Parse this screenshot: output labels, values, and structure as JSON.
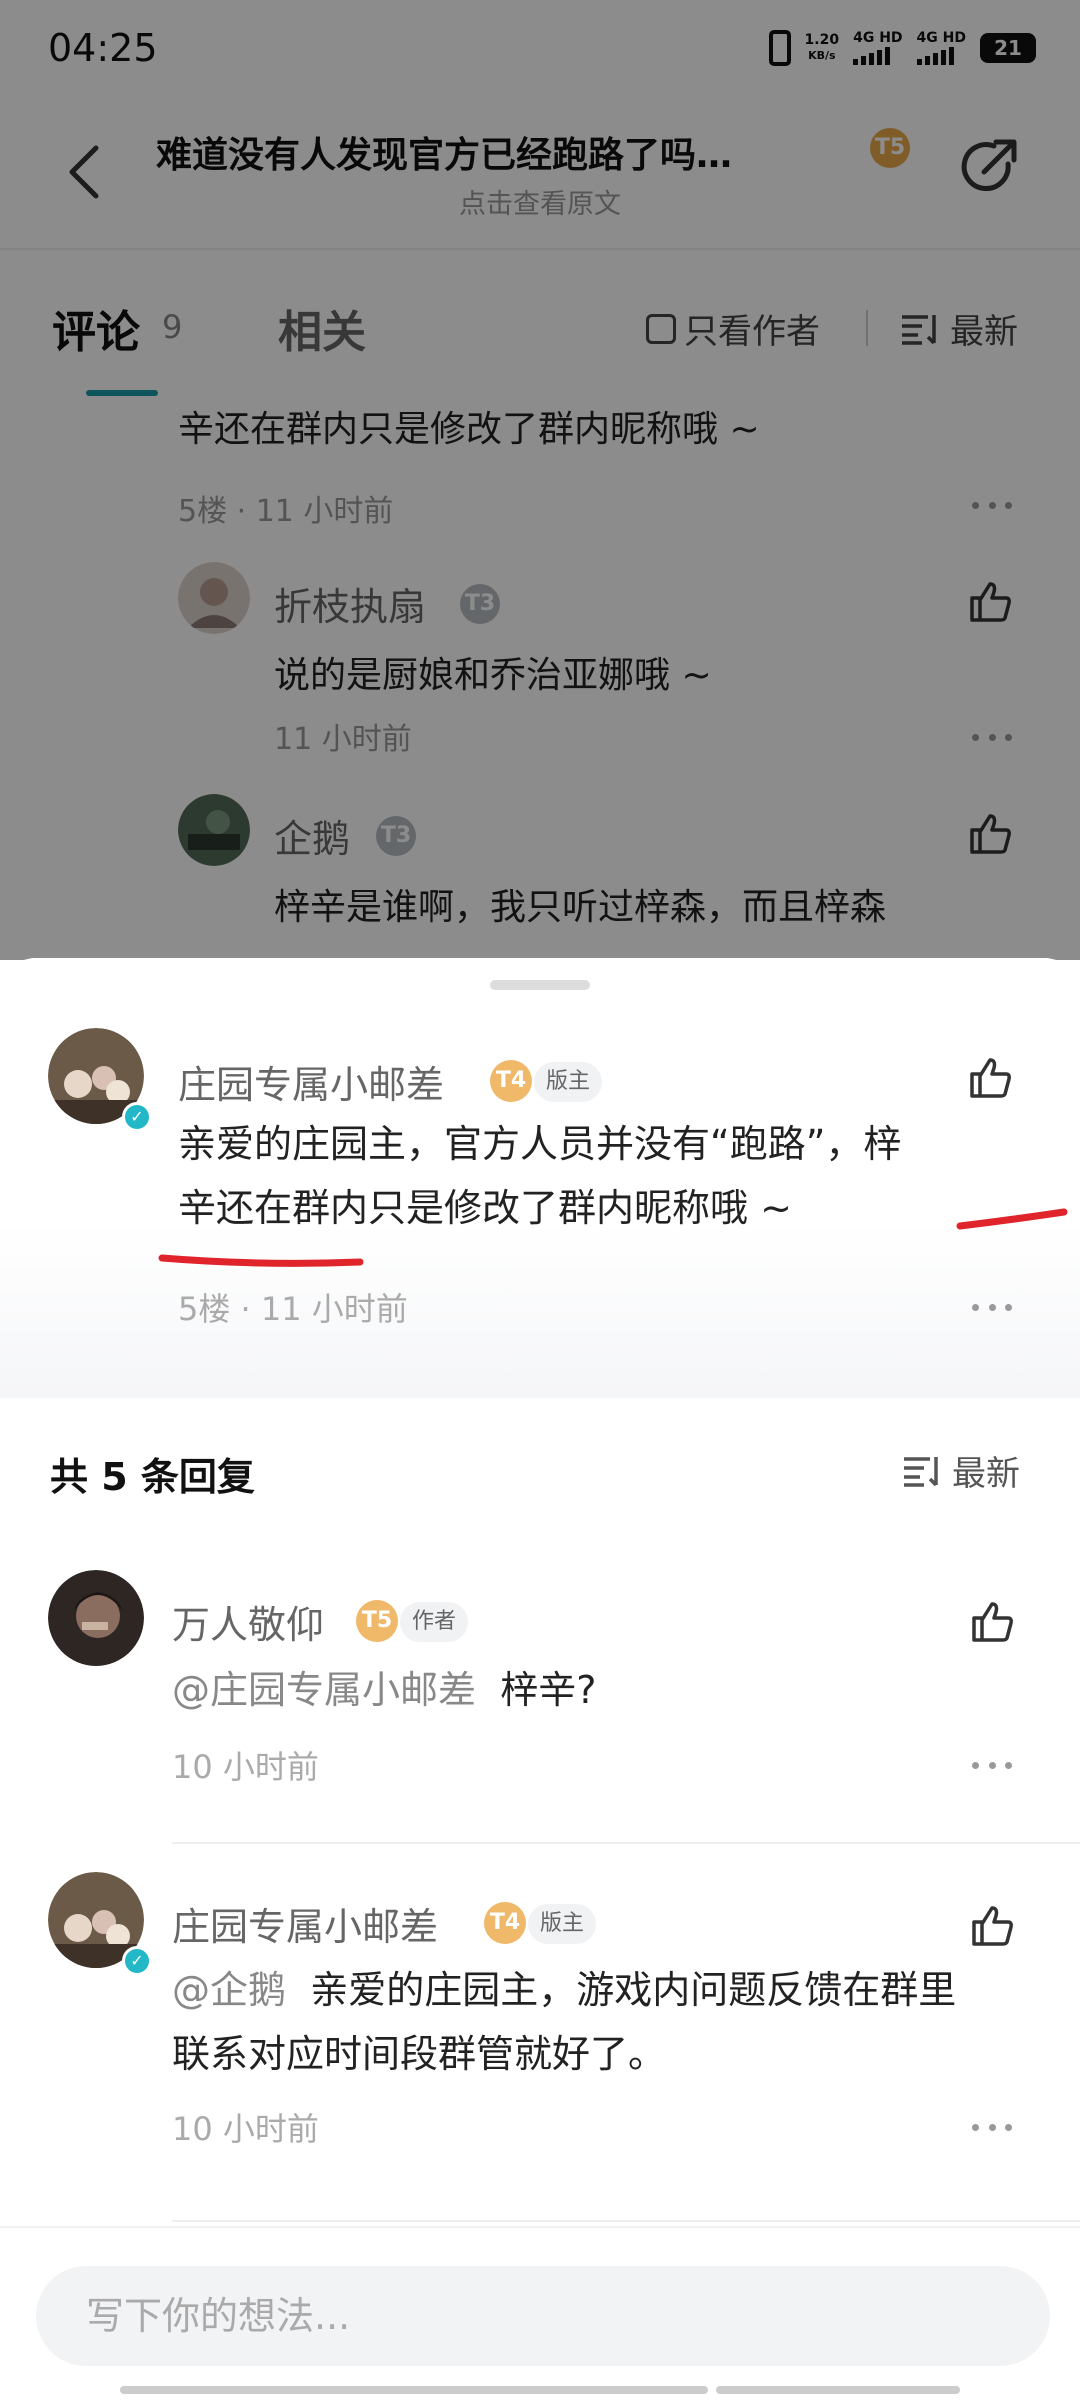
{
  "status_bar": {
    "time": "04:25",
    "speed_value": "1.20",
    "speed_unit": "KB/s",
    "net1": "4G HD",
    "net2": "4G HD",
    "battery": "21"
  },
  "header": {
    "title": "难道没有人发现官方已经跑路了吗…",
    "subtitle": "点击查看原文",
    "author_level": "T5"
  },
  "tabs": {
    "comments_label": "评论",
    "comments_count": "9",
    "related_label": "相关",
    "author_only_label": "只看作者",
    "sort_label": "最新"
  },
  "background_thread": {
    "top_text": "辛还在群内只是修改了群内昵称哦 ~",
    "top_meta": "5楼  ·  11 小时前",
    "replies": [
      {
        "name": "折枝执扇",
        "level": "T3",
        "text": "说的是厨娘和乔治亚娜哦 ~",
        "time": "11 小时前"
      },
      {
        "name": "企鹅",
        "level": "T3",
        "text": "梓辛是谁啊，我只听过梓森，而且梓森"
      }
    ]
  },
  "main_comment": {
    "name": "庄园专属小邮差",
    "level": "T4",
    "role": "版主",
    "text_line1": "亲爱的庄园主，官方人员并没有“跑路”，梓",
    "text_line2": "辛还在群内只是修改了群内昵称哦 ~",
    "floor": "5楼",
    "time": "11 小时前"
  },
  "replies_header": {
    "label": "共 5 条回复",
    "sort_label": "最新"
  },
  "replies": [
    {
      "name": "万人敬仰",
      "level": "T5",
      "role": "作者",
      "mention": "@庄园专属小邮差",
      "text": "梓辛?",
      "time": "10 小时前"
    },
    {
      "name": "庄园专属小邮差",
      "level": "T4",
      "role": "版主",
      "mention": "@企鹅",
      "text_line1": "亲爱的庄园主，游戏内问题反馈在群里",
      "text_line2": "联系对应时间段群管就好了。",
      "time": "10 小时前"
    }
  ],
  "input": {
    "placeholder": "写下你的想法..."
  },
  "colors": {
    "accent": "#1b9aa8",
    "level_gold": "#f0b869",
    "annotation_red": "#e0242c",
    "verified": "#23b8c8"
  }
}
